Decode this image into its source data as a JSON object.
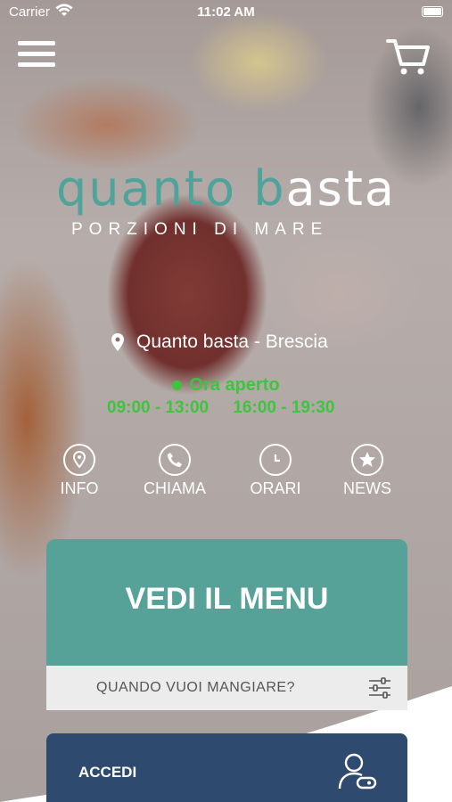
{
  "status": {
    "carrier": "Carrier",
    "time": "11:02 AM"
  },
  "logo": {
    "brand_part1": "quanto",
    "brand_part2": "b",
    "brand_part3": "asta",
    "tagline": "PORZIONI DI MARE"
  },
  "location": {
    "text": "Quanto basta - Brescia"
  },
  "open_status": {
    "label": "Ora aperto",
    "hours": [
      "09:00 - 13:00",
      "16:00 - 19:30"
    ],
    "color": "#3ec43e"
  },
  "actions": [
    {
      "label": "INFO",
      "icon": "location-pin-icon"
    },
    {
      "label": "CHIAMA",
      "icon": "phone-icon"
    },
    {
      "label": "ORARI",
      "icon": "clock-icon"
    },
    {
      "label": "NEWS",
      "icon": "star-icon"
    }
  ],
  "menu_button": {
    "label": "VEDI IL MENU",
    "color": "#56a298"
  },
  "when_bar": {
    "label": "QUANDO VUOI MANGIARE?",
    "icon": "filter-sliders-icon"
  },
  "login": {
    "label": "ACCEDI",
    "icon": "user-login-icon",
    "color": "#2f4a6f"
  }
}
